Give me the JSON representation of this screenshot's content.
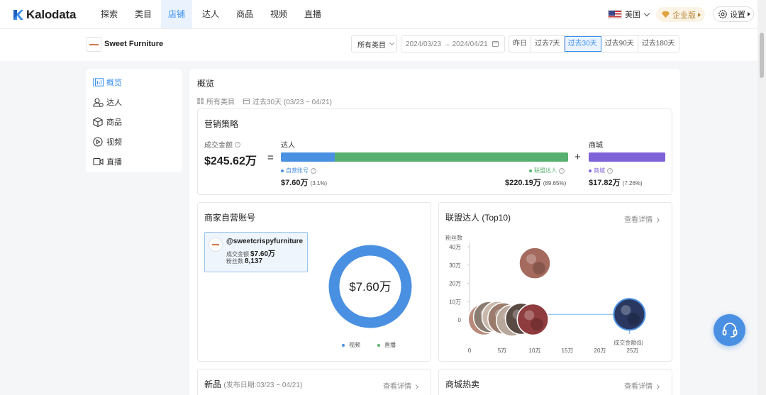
{
  "app": {
    "name": "Kalodata"
  },
  "nav": {
    "items": [
      "探索",
      "类目",
      "店铺",
      "达人",
      "商品",
      "视频",
      "直播"
    ],
    "active": "店铺",
    "region": "美国",
    "enterprise": "企业版",
    "settings": "设置"
  },
  "store": {
    "name": "Sweet Furniture",
    "category_select": "所有类目",
    "date_range": "2024/03/23 → 2024/04/21",
    "periods": [
      "昨日",
      "过去7天",
      "过去30天",
      "过去90天",
      "过去180天"
    ],
    "active_period": "过去30天"
  },
  "sidebar": {
    "items": [
      {
        "label": "概览",
        "icon": "overview-chart-icon"
      },
      {
        "label": "达人",
        "icon": "user-group-icon"
      },
      {
        "label": "商品",
        "icon": "box-icon"
      },
      {
        "label": "视频",
        "icon": "play-circle-icon"
      },
      {
        "label": "直播",
        "icon": "video-camera-icon"
      }
    ],
    "active": "概览"
  },
  "overview": {
    "title": "概览",
    "filter_category": "所有类目",
    "filter_period": "过去30天 (03/23 ~ 04/21)"
  },
  "marketing": {
    "title": "营销策略",
    "total_label": "成交金额",
    "total": "$245.62万",
    "equals": "=",
    "plus": "+",
    "daren_label": "达人",
    "mall_label": "商城",
    "self_label": "自营账号",
    "self_value": "$7.60万",
    "self_pct": "(3.1%)",
    "alliance_label": "联盟达人",
    "alliance_value": "$220.19万",
    "alliance_pct": "(89.65%)",
    "mall_item_label": "商城",
    "mall_value": "$17.82万",
    "mall_pct": "(7.26%)",
    "shares": {
      "self": 3.1,
      "alliance": 89.65,
      "mall": 7.26
    },
    "colors": {
      "self": "#4a90e2",
      "alliance": "#57b06f",
      "mall": "#7e62d8"
    }
  },
  "self_account": {
    "title": "商家自营账号",
    "handle": "@sweetcrispyfurniture",
    "gmv_label": "成交金额",
    "gmv": "$7.60万",
    "fans_label": "粉丝数",
    "fans": "8,137",
    "donut_center": "$7.60万",
    "legend": [
      {
        "label": "视频",
        "color": "#4a90e2"
      },
      {
        "label": "直播",
        "color": "#57b06f"
      }
    ]
  },
  "alliance_top10": {
    "title": "联盟达人 (Top10)",
    "detail": "查看详情",
    "y_axis_title": "粉丝数",
    "x_axis_title": "成交金额($)"
  },
  "chart_data": {
    "type": "scatter",
    "ylabel": "粉丝数",
    "xlabel": "成交金额($)",
    "x_ticks": [
      "0",
      "5万",
      "10万",
      "15万",
      "20万",
      "25万"
    ],
    "y_ticks": [
      "0",
      "10万",
      "20万",
      "30万",
      "40万"
    ],
    "xlim": [
      0,
      25
    ],
    "ylim": [
      0,
      40
    ],
    "x_unit": "万",
    "y_unit": "万",
    "points": [
      {
        "x": 2.2,
        "y": 0.2,
        "color": "#b98a7a"
      },
      {
        "x": 3.0,
        "y": 1.5,
        "color": "#8a7c70"
      },
      {
        "x": 4.3,
        "y": 1.6,
        "color": "#c9b9ad"
      },
      {
        "x": 5.2,
        "y": 0.8,
        "color": "#9a7b6c"
      },
      {
        "x": 6.5,
        "y": -0.4,
        "color": "#b8a89c"
      },
      {
        "x": 7.9,
        "y": 0.6,
        "color": "#5a4a44"
      },
      {
        "x": 9.7,
        "y": 0.2,
        "color": "#8f3c3e"
      },
      {
        "x": 10.0,
        "y": 31.0,
        "color": "#a46a5e"
      },
      {
        "x": 24.5,
        "y": 3.0,
        "color": "#2a3760"
      }
    ]
  },
  "new_products": {
    "title": "新品",
    "subtitle": "(发布日期:03/23 ~ 04/21)",
    "detail": "查看详情"
  },
  "mall_hot": {
    "title": "商城热卖",
    "detail": "查看详情"
  }
}
